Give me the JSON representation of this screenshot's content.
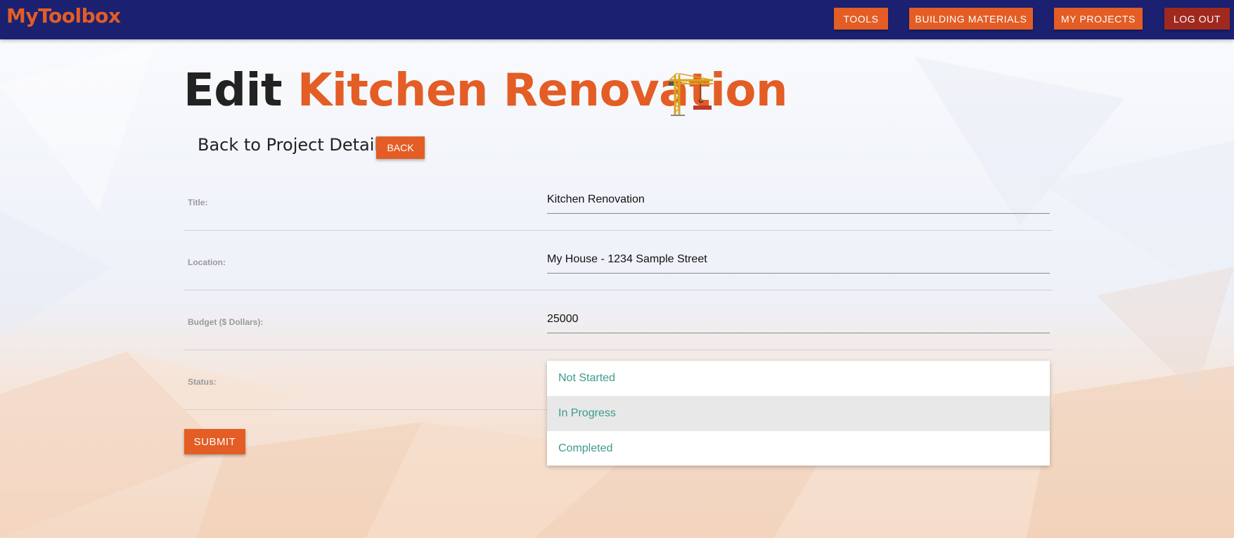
{
  "colors": {
    "navbar": "#1b2170",
    "accent": "#e35d25",
    "logout": "#a0291f",
    "option_text": "#3d9a8b"
  },
  "navbar": {
    "brand": "MyToolbox",
    "links": {
      "tools": "TOOLS",
      "building_materials": "BUILDING MATERIALS",
      "my_projects": "MY PROJECTS",
      "logout": "LOG OUT"
    }
  },
  "heading": {
    "prefix": "Edit",
    "project_name": "Kitchen Renovation",
    "icon": "construction-crane-icon"
  },
  "back": {
    "text": "Back to Project Details",
    "button": "BACK"
  },
  "form": {
    "title": {
      "label": "Title:",
      "value": "Kitchen Renovation"
    },
    "location": {
      "label": "Location:",
      "value": "My House - 1234 Sample Street"
    },
    "budget": {
      "label": "Budget ($ Dollars):",
      "value": "25000"
    },
    "status": {
      "label": "Status:",
      "options": [
        "Not Started",
        "In Progress",
        "Completed"
      ],
      "highlighted": "In Progress"
    },
    "submit": "SUBMIT"
  }
}
